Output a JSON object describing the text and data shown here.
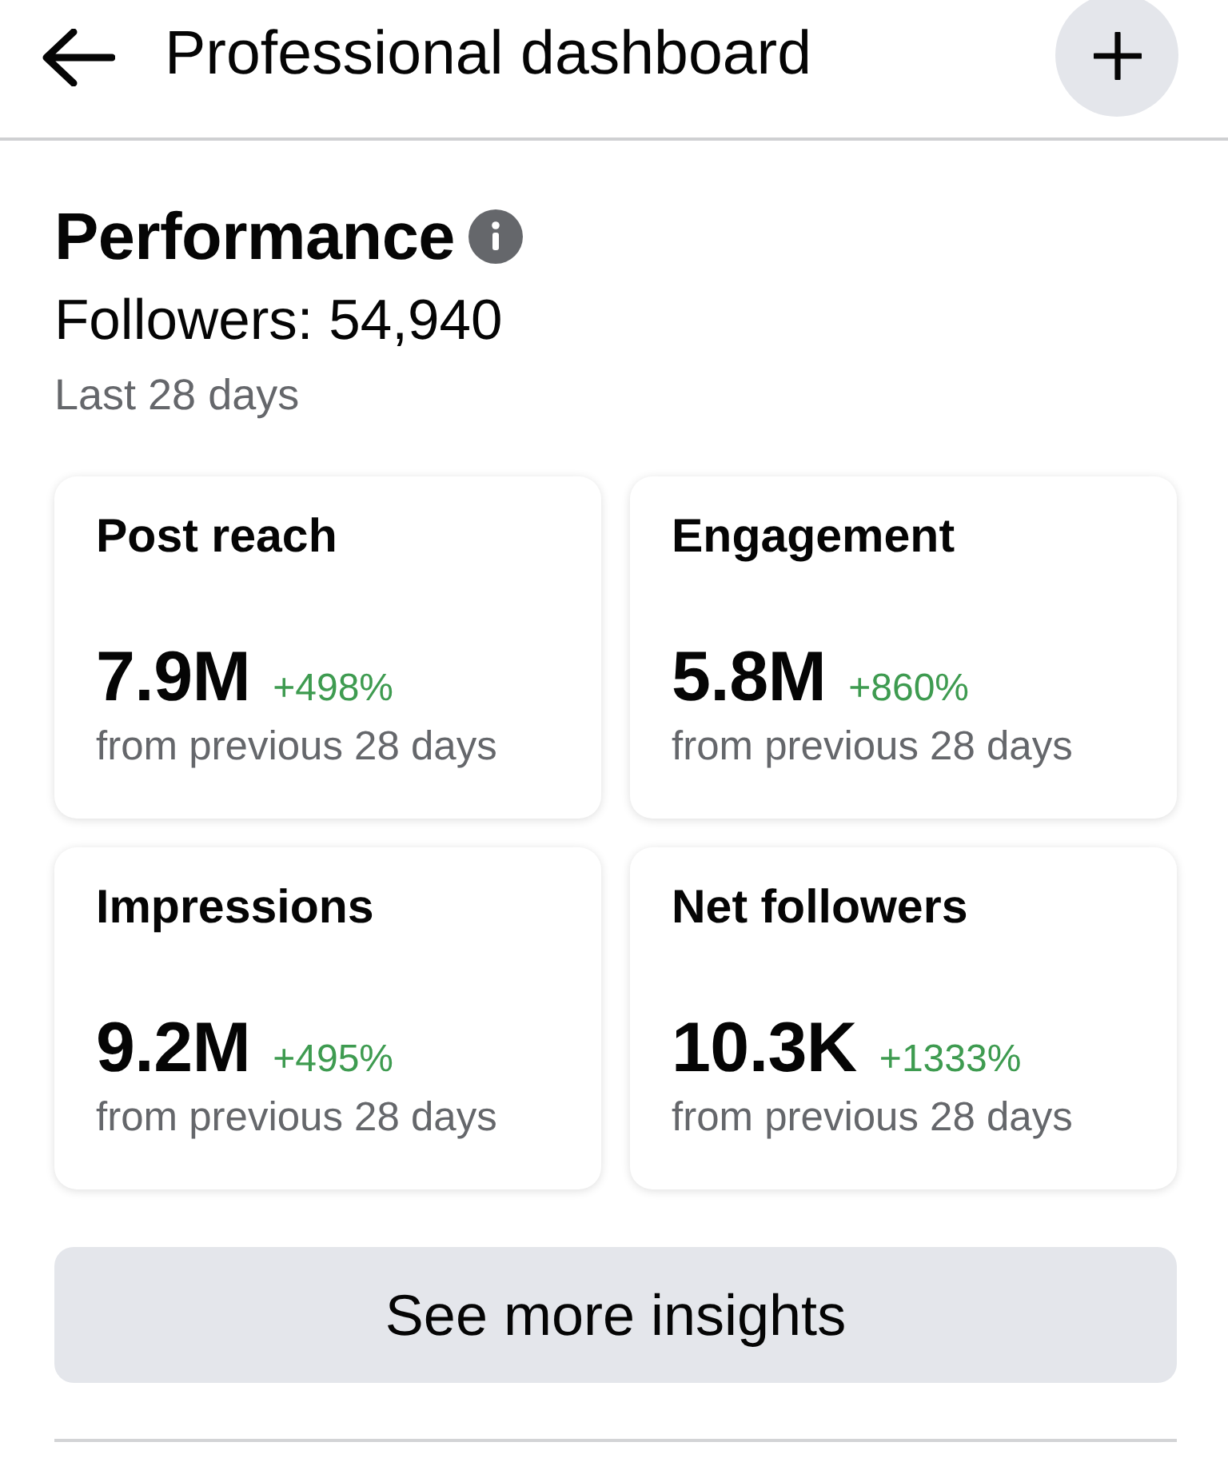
{
  "header": {
    "title": "Professional dashboard"
  },
  "performance": {
    "title": "Performance",
    "followers": "Followers: 54,940",
    "period": "Last 28 days"
  },
  "metrics": [
    {
      "label": "Post reach",
      "value": "7.9M",
      "change": "+498%",
      "comparison": "from previous 28 days"
    },
    {
      "label": "Engagement",
      "value": "5.8M",
      "change": "+860%",
      "comparison": "from previous 28 days"
    },
    {
      "label": "Impressions",
      "value": "9.2M",
      "change": "+495%",
      "comparison": "from previous 28 days"
    },
    {
      "label": "Net followers",
      "value": "10.3K",
      "change": "+1333%",
      "comparison": "from previous 28 days"
    }
  ],
  "button": {
    "label": "See more insights"
  }
}
